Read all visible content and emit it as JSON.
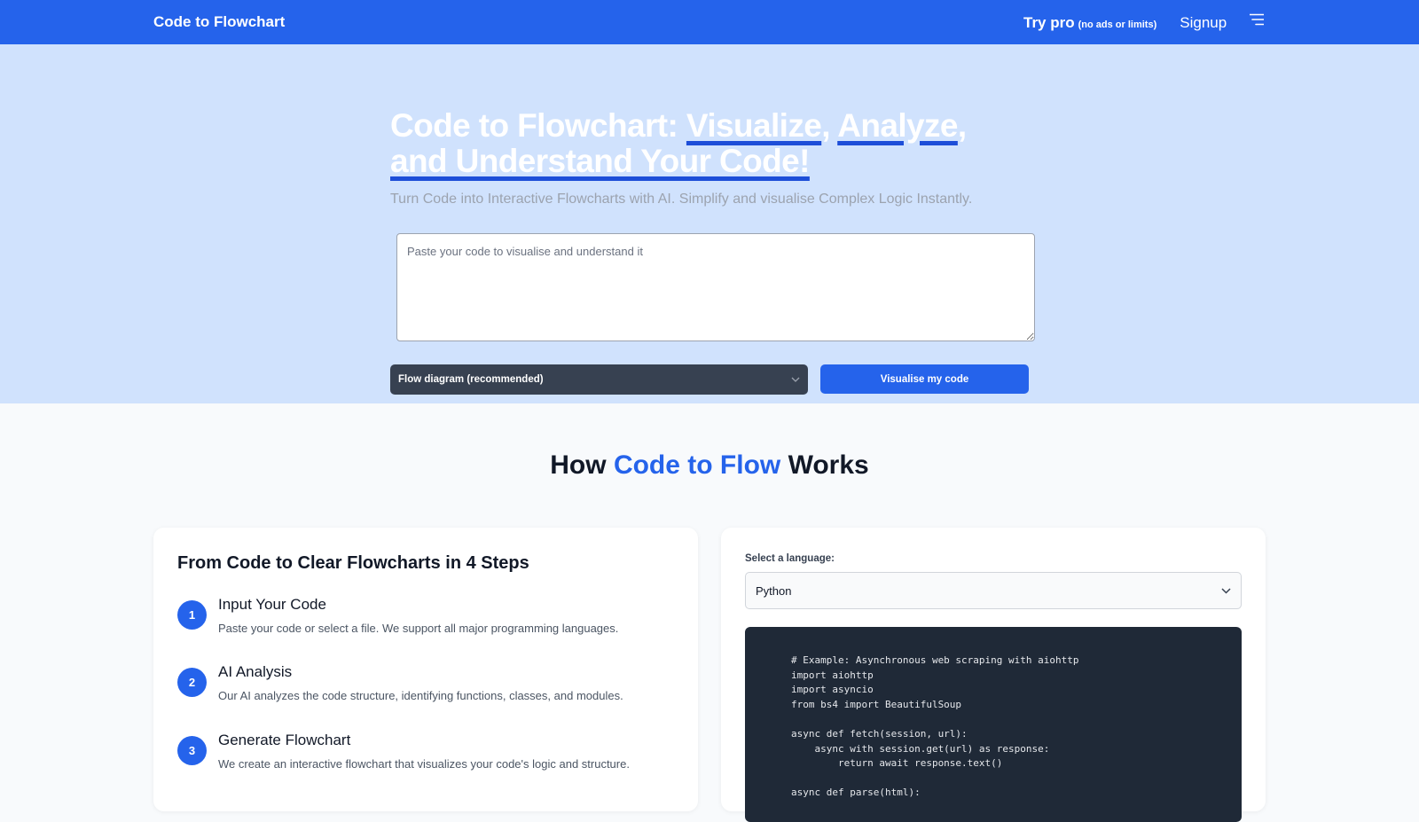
{
  "navbar": {
    "brand": "Code to Flowchart",
    "try_pro": "Try pro",
    "try_pro_note": "(no ads or limits)",
    "signup": "Signup",
    "menu_icon": "menu-icon"
  },
  "hero": {
    "title_prefix": "Code to Flowchart: ",
    "title_visualize": "Visualize",
    "title_comma1": ", ",
    "title_analyze": "Analyze",
    "title_comma2": ",",
    "title_space": " ",
    "title_understand": "and Understand Your Code!",
    "subtitle": "Turn Code into Interactive Flowcharts with AI. Simplify and visualise Complex Logic Instantly.",
    "code_placeholder": "Paste your code to visualise and understand it",
    "diagram_select": "Flow diagram (recommended)",
    "visualise_button": "Visualise my code"
  },
  "how": {
    "title_before": "How ",
    "title_accent": "Code to Flow",
    "title_after": " Works"
  },
  "steps": {
    "title": "From Code to Clear Flowcharts in 4 Steps",
    "items": [
      {
        "num": "1",
        "title": "Input Your Code",
        "desc": "Paste your code or select a file. We support all major programming languages."
      },
      {
        "num": "2",
        "title": "AI Analysis",
        "desc": "Our AI analyzes the code structure, identifying functions, classes, and modules."
      },
      {
        "num": "3",
        "title": "Generate Flowchart",
        "desc": "We create an interactive flowchart that visualizes your code's logic and structure."
      }
    ]
  },
  "example": {
    "language_label": "Select a language:",
    "language_value": "Python",
    "code": "# Example: Asynchronous web scraping with aiohttp\nimport aiohttp\nimport asyncio\nfrom bs4 import BeautifulSoup\n\nasync def fetch(session, url):\n    async with session.get(url) as response:\n        return await response.text()\n\nasync def parse(html):"
  },
  "colors": {
    "primary": "#2563eb",
    "hero_bg": "#d0e2fd",
    "dark_select": "#374151",
    "code_bg": "#1f2937"
  }
}
